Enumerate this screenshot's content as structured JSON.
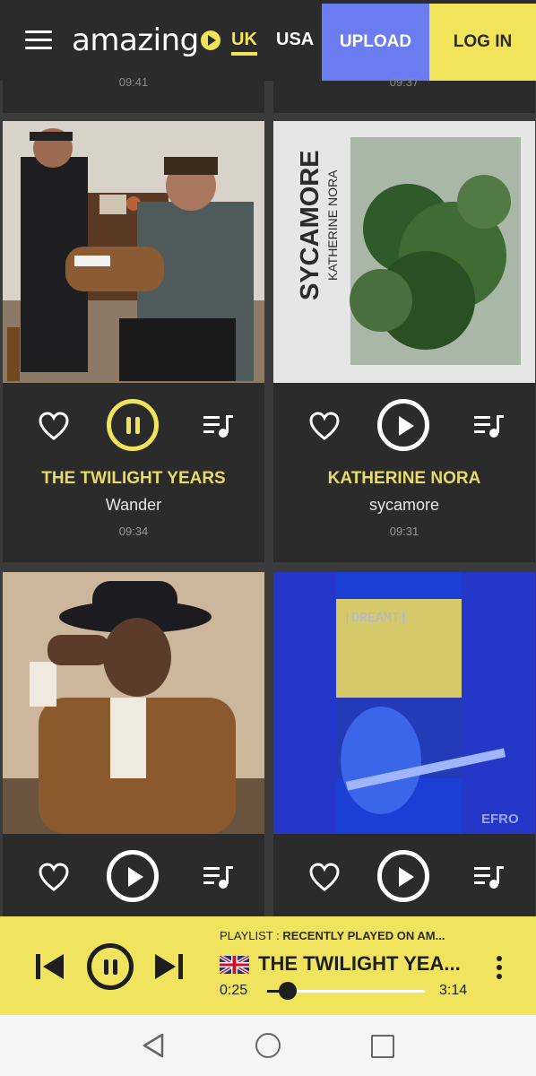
{
  "header": {
    "logo_text": "amazing",
    "regions": [
      "UK",
      "USA"
    ],
    "active_region": "UK",
    "upload_label": "UPLOAD",
    "login_label": "LOG IN",
    "accent_color": "#f2e45a",
    "upload_color": "#6a7cf0"
  },
  "top_strip": {
    "left_time": "09:41",
    "right_time": "09:37"
  },
  "cards": [
    {
      "artist": "THE TWILIGHT YEARS",
      "track": "Wander",
      "time": "09:34",
      "state": "playing"
    },
    {
      "artist": "KATHERINE NORA",
      "track": "sycamore",
      "time": "09:31",
      "state": "paused",
      "art_text_big": "SYCAMORE",
      "art_text_small": "KATHERINE NORA"
    },
    {
      "artist": "",
      "track": "",
      "time": "",
      "state": "paused"
    },
    {
      "artist": "",
      "track": "",
      "time": "",
      "state": "paused",
      "art_text_top": "|DREAMT|",
      "art_text_corner": "EFRO"
    }
  ],
  "player": {
    "playlist_prefix": "PLAYLIST :",
    "playlist_name": "RECENTLY PLAYED ON AM...",
    "title": "THE TWILIGHT YEA...",
    "current_time": "0:25",
    "duration": "3:14",
    "progress": 0.13
  }
}
